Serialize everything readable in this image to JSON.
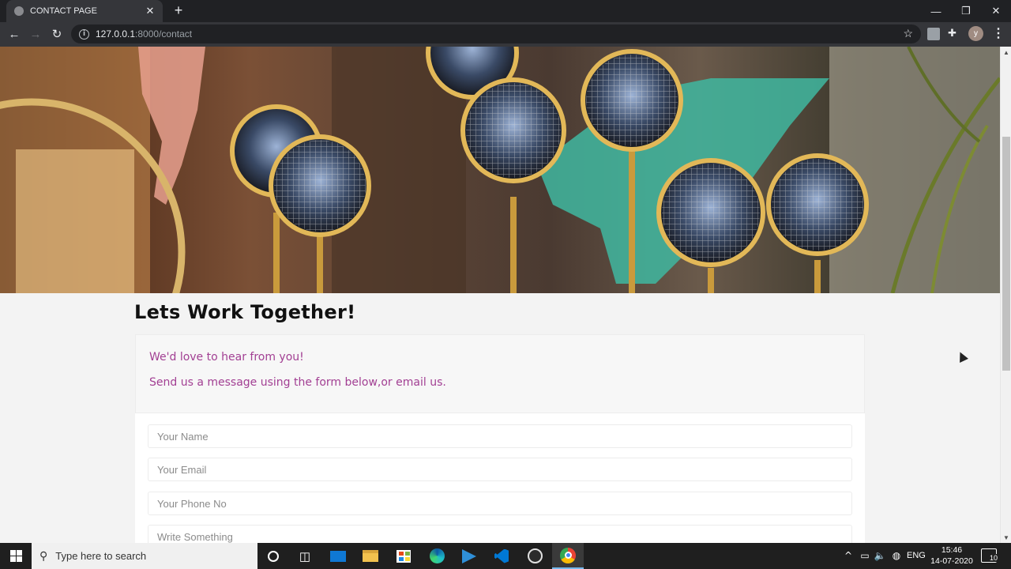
{
  "browser": {
    "tab_title": "CONTACT PAGE",
    "url_host": "127.0.0.1",
    "url_path": ":8000/contact",
    "profile_initial": "y"
  },
  "page": {
    "heading": "Lets Work Together!",
    "intro_line1": "We'd love to hear from you!",
    "intro_line2": "Send us a message using the form below,or email us.",
    "form": {
      "name_placeholder": "Your Name",
      "email_placeholder": "Your Email",
      "phone_placeholder": "Your Phone No",
      "message_placeholder": "Write Something"
    },
    "accent_color": "#a23f93"
  },
  "taskbar": {
    "search_placeholder": "Type here to search",
    "language": "ENG",
    "time": "15:46",
    "date": "14-07-2020",
    "notification_count": "10"
  }
}
